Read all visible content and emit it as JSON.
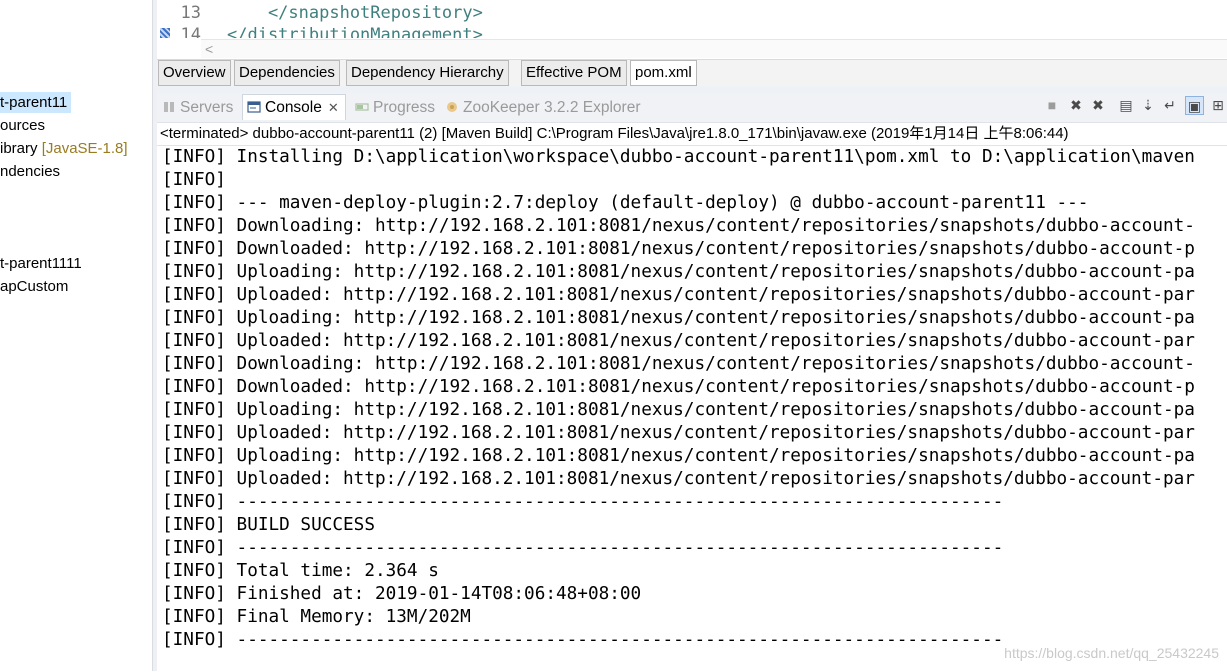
{
  "left_tree": {
    "items": [
      {
        "text": "t-parent11",
        "selected": true
      },
      {
        "text": "ources"
      },
      {
        "text": "ibrary ",
        "decoration": "[JavaSE-1.8]"
      },
      {
        "text": "ndencies"
      },
      {
        "text": "t-parent1111"
      },
      {
        "text": "apCustom"
      }
    ]
  },
  "editor": {
    "lines": [
      {
        "number": "13",
        "code": "    </snapshotRepository>"
      },
      {
        "number": "14",
        "code": "</distributionManagement>"
      }
    ],
    "scroll_left_arrow": "<",
    "tabs": [
      "Overview",
      "Dependencies",
      "Dependency Hierarchy",
      "Effective POM",
      "pom.xml"
    ],
    "active_tab": "pom.xml"
  },
  "views": {
    "tabs": [
      {
        "label": "Servers",
        "icon": "servers-icon",
        "active": false
      },
      {
        "label": "Console",
        "icon": "console-icon",
        "active": true
      },
      {
        "label": "Progress",
        "icon": "progress-icon",
        "active": false
      },
      {
        "label": "ZooKeeper 3.2.2 Explorer",
        "icon": "zookeeper-icon",
        "active": false
      }
    ],
    "close_glyph": "✕",
    "toolbar": [
      {
        "name": "stop-icon",
        "glyph": "■"
      },
      {
        "name": "remove-launch-icon",
        "glyph": "✖"
      },
      {
        "name": "remove-all-icon",
        "glyph": "✖"
      },
      {
        "name": "clear-console-icon",
        "glyph": "▤"
      },
      {
        "name": "scroll-lock-icon",
        "glyph": "⇣"
      },
      {
        "name": "word-wrap-icon",
        "glyph": "↵"
      },
      {
        "name": "show-console-icon",
        "glyph": "▣",
        "on": true
      },
      {
        "name": "pin-console-icon",
        "glyph": "⊞"
      }
    ]
  },
  "console": {
    "header": "<terminated> dubbo-account-parent11 (2) [Maven Build] C:\\Program Files\\Java\\jre1.8.0_171\\bin\\javaw.exe (2019年1月14日 上午8:06:44)",
    "lines": [
      "[INFO] Installing D:\\application\\workspace\\dubbo-account-parent11\\pom.xml to D:\\application\\maven",
      "[INFO]",
      "[INFO] --- maven-deploy-plugin:2.7:deploy (default-deploy) @ dubbo-account-parent11 ---",
      "[INFO] Downloading: http://192.168.2.101:8081/nexus/content/repositories/snapshots/dubbo-account-",
      "[INFO] Downloaded: http://192.168.2.101:8081/nexus/content/repositories/snapshots/dubbo-account-p",
      "[INFO] Uploading: http://192.168.2.101:8081/nexus/content/repositories/snapshots/dubbo-account-pa",
      "[INFO] Uploaded: http://192.168.2.101:8081/nexus/content/repositories/snapshots/dubbo-account-par",
      "[INFO] Uploading: http://192.168.2.101:8081/nexus/content/repositories/snapshots/dubbo-account-pa",
      "[INFO] Uploaded: http://192.168.2.101:8081/nexus/content/repositories/snapshots/dubbo-account-par",
      "[INFO] Downloading: http://192.168.2.101:8081/nexus/content/repositories/snapshots/dubbo-account-",
      "[INFO] Downloaded: http://192.168.2.101:8081/nexus/content/repositories/snapshots/dubbo-account-p",
      "[INFO] Uploading: http://192.168.2.101:8081/nexus/content/repositories/snapshots/dubbo-account-pa",
      "[INFO] Uploaded: http://192.168.2.101:8081/nexus/content/repositories/snapshots/dubbo-account-par",
      "[INFO] Uploading: http://192.168.2.101:8081/nexus/content/repositories/snapshots/dubbo-account-pa",
      "[INFO] Uploaded: http://192.168.2.101:8081/nexus/content/repositories/snapshots/dubbo-account-par",
      "[INFO] ------------------------------------------------------------------------",
      "[INFO] BUILD SUCCESS",
      "[INFO] ------------------------------------------------------------------------",
      "[INFO] Total time: 2.364 s",
      "[INFO] Finished at: 2019-01-14T08:06:48+08:00",
      "[INFO] Final Memory: 13M/202M",
      "[INFO] ------------------------------------------------------------------------"
    ]
  },
  "watermark": "https://blog.csdn.net/qq_25432245",
  "colors": {
    "selection": "#cce8ff",
    "xml_tag": "#3f7f7f",
    "decoration": "#9a7b20"
  }
}
